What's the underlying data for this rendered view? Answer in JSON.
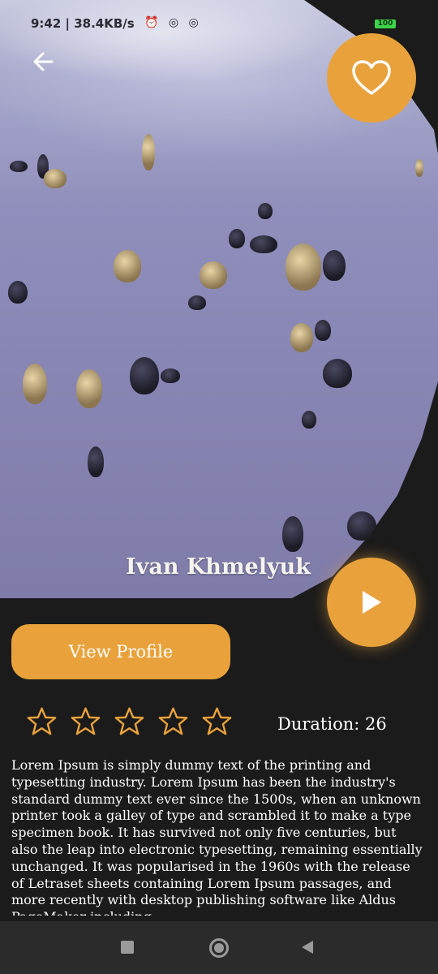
{
  "status_bar": {
    "text": "9:42 | 38.4KB/s",
    "icons": "⏰ ◎ ◎",
    "battery": "100"
  },
  "hero": {
    "artist_name": "Ivan Khmelyuk"
  },
  "actions": {
    "view_profile_label": "View Profile"
  },
  "rating": {
    "stars_total": 5,
    "stars_filled": 0
  },
  "duration_text": "Duration: 26",
  "description": "Lorem Ipsum is simply dummy text of the printing and typesetting industry. Lorem Ipsum has been the industry's standard dummy text ever since the 1500s, when an unknown printer took a galley of type and scrambled it to make a type specimen book. It has survived not only five centuries, but also the leap into electronic typesetting, remaining essentially unchanged. It was popularised in the 1960s with the release of Letraset sheets containing Lorem Ipsum passages, and more recently with desktop publishing software like Aldus PageMaker including",
  "colors": {
    "accent": "#e9a23b",
    "background": "#1b1b1b",
    "text": "#ffffff"
  },
  "icons": {
    "back": "arrow-left-icon",
    "favorite": "heart-outline-icon",
    "play": "play-icon",
    "star": "star-outline-icon"
  }
}
